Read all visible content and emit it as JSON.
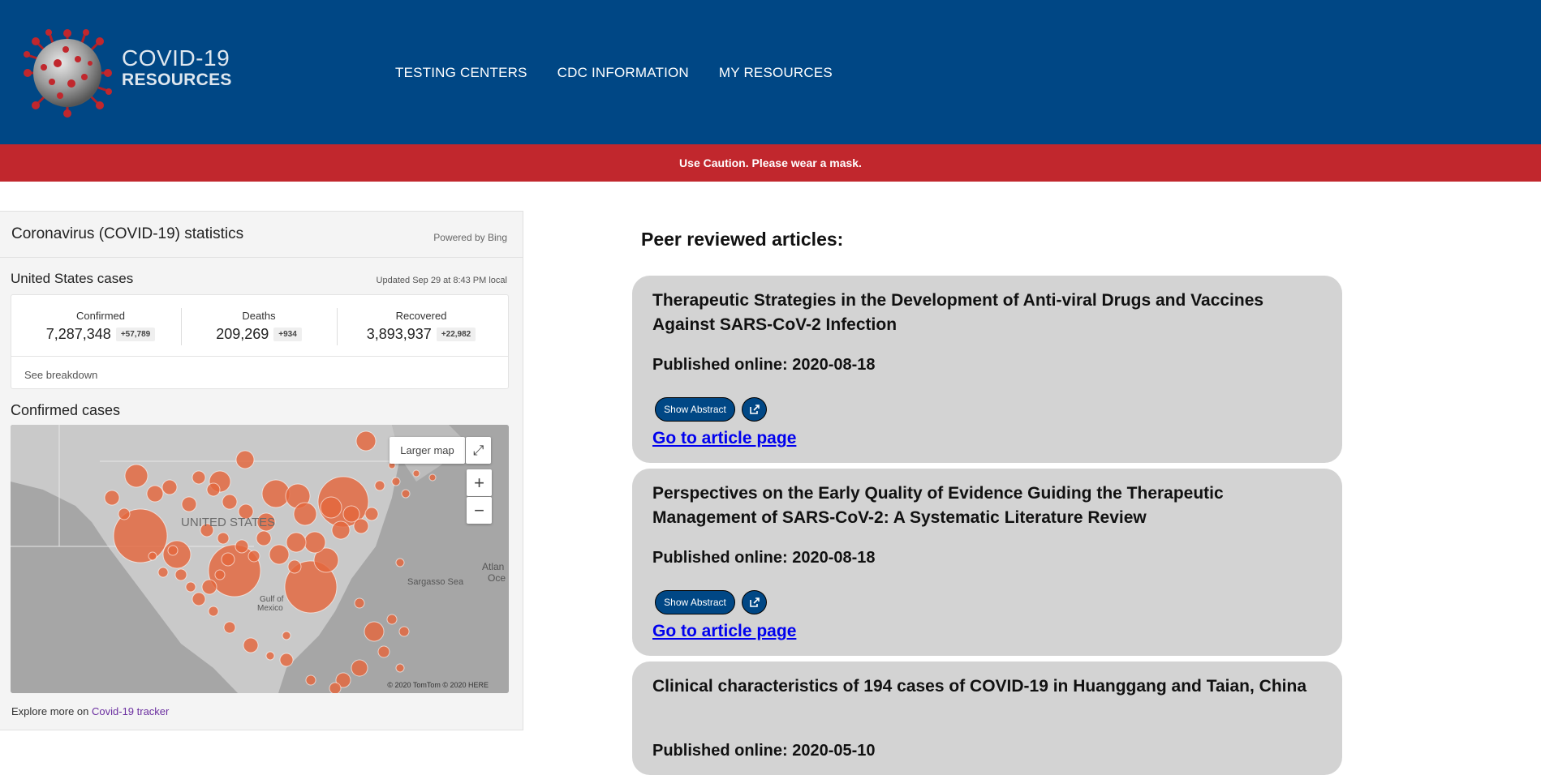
{
  "header": {
    "logo_line1": "COVID-19",
    "logo_line2": "RESOURCES",
    "nav": [
      "TESTING CENTERS",
      "CDC INFORMATION",
      "MY RESOURCES"
    ],
    "background_color": "#004785"
  },
  "banner": {
    "text": "Use Caution. Please wear a mask.",
    "color": "#c1272d"
  },
  "stats_widget": {
    "title": "Coronavirus (COVID-19) statistics",
    "powered_by": "Powered by Bing",
    "region_title": "United States cases",
    "updated": "Updated Sep 29 at 8:43 PM local",
    "stats": [
      {
        "label": "Confirmed",
        "value": "7,287,348",
        "delta": "+57,789"
      },
      {
        "label": "Deaths",
        "value": "209,269",
        "delta": "+934"
      },
      {
        "label": "Recovered",
        "value": "3,893,937",
        "delta": "+22,982"
      }
    ],
    "breakdown_link": "See breakdown",
    "map_title": "Confirmed cases",
    "map": {
      "larger_map": "Larger map",
      "labels": [
        "UNITED STATES",
        "Sargasso Sea",
        "Gulf of",
        "Mexico",
        "Atlan",
        "Oce"
      ],
      "copyright": "© 2020 TomTom © 2020 HERE",
      "bubble_color": "#e4673d"
    },
    "explore_text": "Explore more on ",
    "explore_link": "Covid-19 tracker"
  },
  "articles": {
    "heading": "Peer reviewed articles:",
    "items": [
      {
        "title": "Therapeutic Strategies in the Development of Anti-viral Drugs and Vaccines Against SARS-CoV-2 Infection",
        "published": "Published online: 2020-08-18",
        "show_abstract": "Show Abstract",
        "link": "Go to article page"
      },
      {
        "title": "Perspectives on the Early Quality of Evidence Guiding the Therapeutic Management of SARS-CoV-2: A Systematic Literature Review",
        "published": "Published online: 2020-08-18",
        "show_abstract": "Show Abstract",
        "link": "Go to article page"
      },
      {
        "title": "Clinical characteristics of 194 cases of COVID-19 in Huanggang and Taian, China",
        "published": "Published online: 2020-05-10"
      }
    ]
  }
}
